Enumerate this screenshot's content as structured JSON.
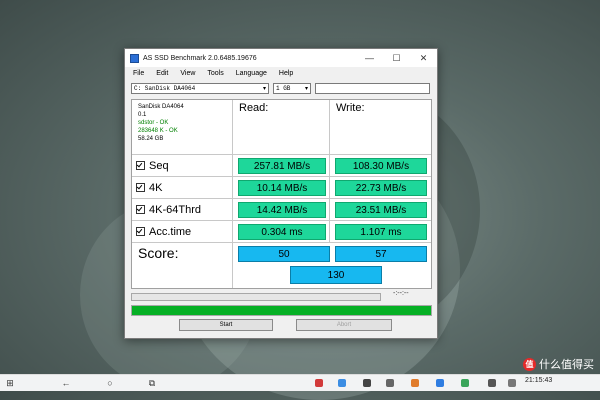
{
  "window": {
    "title": "AS SSD Benchmark 2.0.6485.19676",
    "minimize": "—",
    "maximize": "☐",
    "close": "✕"
  },
  "menu": [
    "File",
    "Edit",
    "View",
    "Tools",
    "Language",
    "Help"
  ],
  "toolbar": {
    "drive": "C: SanDisk DA4064",
    "size": "1 GB"
  },
  "drive_info": {
    "name": "SanDisk DA4064",
    "version": "0.1",
    "driver": "sdstor - OK",
    "align": "283648 K - OK",
    "capacity": "58.24 GB"
  },
  "columns": {
    "read": "Read:",
    "write": "Write:"
  },
  "rows": [
    {
      "label": "Seq",
      "read": "257.81 MB/s",
      "write": "108.30 MB/s"
    },
    {
      "label": "4K",
      "read": "10.14 MB/s",
      "write": "22.73 MB/s"
    },
    {
      "label": "4K-64Thrd",
      "read": "14.42 MB/s",
      "write": "23.51 MB/s"
    },
    {
      "label": "Acc.time",
      "read": "0.304 ms",
      "write": "1.107 ms"
    }
  ],
  "score": {
    "label": "Score:",
    "read": "50",
    "write": "57",
    "total": "130"
  },
  "timer": "-:--:--",
  "progress": {
    "main": 1.0,
    "sub": 0.0
  },
  "buttons": {
    "start": "Start",
    "abort": "Abort"
  },
  "taskbar": {
    "clock": "21:15:43"
  },
  "watermark": {
    "badge": "值",
    "text": "什么值得买"
  },
  "colors": {
    "value_box": "#1ed79a",
    "score_box": "#17b8f0",
    "progress": "#06b025"
  }
}
